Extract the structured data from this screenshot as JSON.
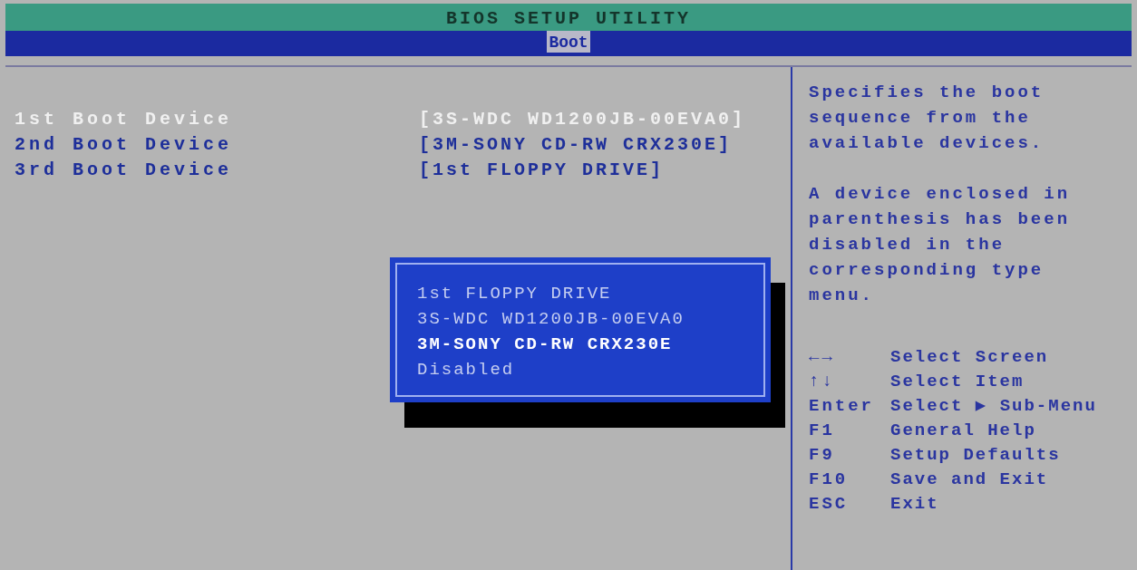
{
  "window": {
    "title": "BIOS SETUP UTILITY"
  },
  "tabs": [
    {
      "label": "Boot",
      "selected": true
    }
  ],
  "boot_devices": [
    {
      "label": "1st Boot Device",
      "value": "[3S-WDC WD1200JB-00EVA0]",
      "selected": true
    },
    {
      "label": "2nd Boot Device",
      "value": "[3M-SONY CD-RW CRX230E]",
      "selected": false
    },
    {
      "label": "3rd Boot Device",
      "value": "[1st FLOPPY DRIVE]",
      "selected": false
    }
  ],
  "popup": {
    "options": [
      {
        "label": "1st FLOPPY DRIVE",
        "selected": false
      },
      {
        "label": "3S-WDC WD1200JB-00EVA0",
        "selected": false
      },
      {
        "label": "3M-SONY CD-RW CRX230E",
        "selected": true
      },
      {
        "label": "Disabled",
        "selected": false
      }
    ]
  },
  "help": {
    "paragraphs": [
      "Specifies the boot sequence from the available devices.",
      "A device enclosed in parenthesis has been disabled in the corresponding type menu."
    ],
    "keys": [
      {
        "key": "←→",
        "action": "Select Screen"
      },
      {
        "key": "↑↓",
        "action": "Select Item"
      },
      {
        "key": "Enter",
        "action": "Select ▶ Sub-Menu"
      },
      {
        "key": "F1",
        "action": "General Help"
      },
      {
        "key": "F9",
        "action": "Setup Defaults"
      },
      {
        "key": "F10",
        "action": "Save and Exit"
      },
      {
        "key": "ESC",
        "action": "Exit"
      }
    ]
  }
}
